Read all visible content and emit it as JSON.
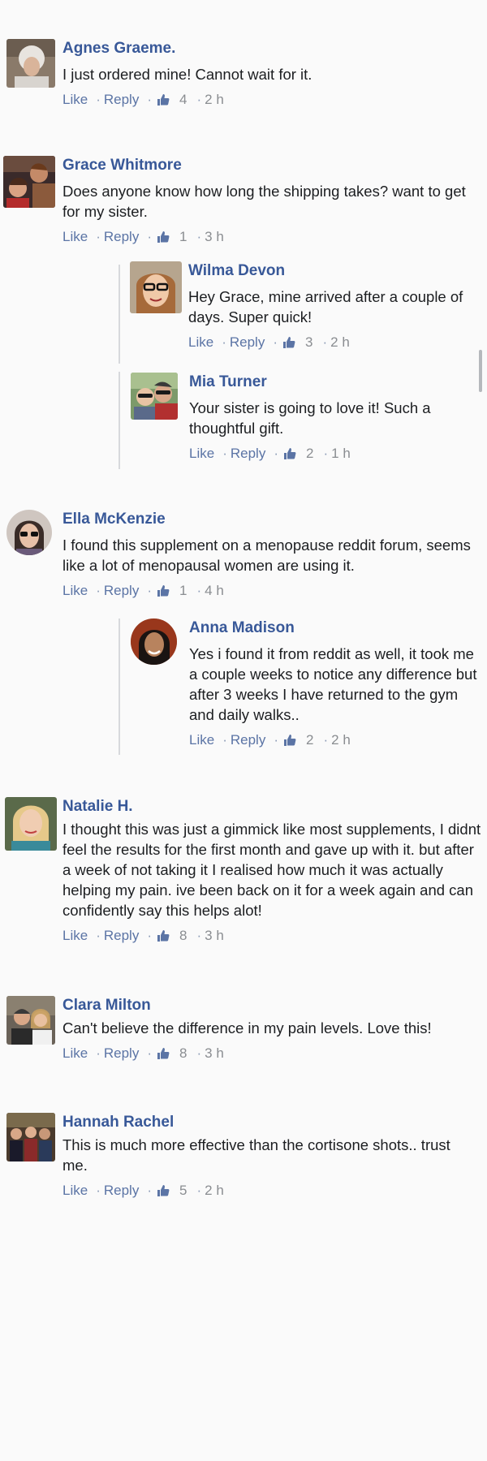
{
  "comments": [
    {
      "name": "Agnes Graeme.",
      "text": "I just ordered mine! Cannot wait for it.",
      "like": "Like",
      "reply": "Reply",
      "count": "4",
      "time": "2 h"
    },
    {
      "name": "Grace Whitmore",
      "text": "Does anyone know how long the shipping takes? want to get for my sister.",
      "like": "Like",
      "reply": "Reply",
      "count": "1",
      "time": "3 h",
      "replies": [
        {
          "name": "Wilma Devon",
          "text": "Hey Grace, mine arrived after a couple of days. Super quick!",
          "like": "Like",
          "reply": "Reply",
          "count": "3",
          "time": "2 h"
        },
        {
          "name": "Mia Turner",
          "text": "Your sister is going to love it! Such a thoughtful gift.",
          "like": "Like",
          "reply": "Reply",
          "count": "2",
          "time": "1 h"
        }
      ]
    },
    {
      "name": "Ella McKenzie",
      "text": "I found this supplement on a menopause reddit forum, seems like a lot of menopausal women are using it.",
      "like": "Like",
      "reply": "Reply",
      "count": "1",
      "time": "4 h",
      "replies": [
        {
          "name": "Anna Madison",
          "text": "Yes i found it from reddit as well, it took me a couple weeks to notice any difference but after 3 weeks I have returned to the gym and daily walks..",
          "like": "Like",
          "reply": "Reply",
          "count": "2",
          "time": "2 h"
        }
      ]
    },
    {
      "name": "Natalie H.",
      "text": "I thought this was just a gimmick like most supplements, I didnt feel the results for the first month and gave up with it. but after a week of not taking it I realised how much it was actually helping my pain. ive been back on it for a week again and can confidently say this helps alot!",
      "like": "Like",
      "reply": "Reply",
      "count": "8",
      "time": "3 h"
    },
    {
      "name": "Clara Milton",
      "text": "Can't believe the difference in my pain levels. Love this!",
      "like": "Like",
      "reply": "Reply",
      "count": "8",
      "time": "3 h"
    },
    {
      "name": "Hannah Rachel",
      "text": "This is much more effective than the cortisone shots.. trust me.",
      "like": "Like",
      "reply": "Reply",
      "count": "5",
      "time": "2 h"
    }
  ],
  "separator": "·",
  "icons": {
    "reaction": "thumbs-up-icon"
  },
  "colors": {
    "name": "#385898",
    "action": "#5b74a5",
    "muted": "#8a8d91",
    "background": "#fafafa"
  }
}
